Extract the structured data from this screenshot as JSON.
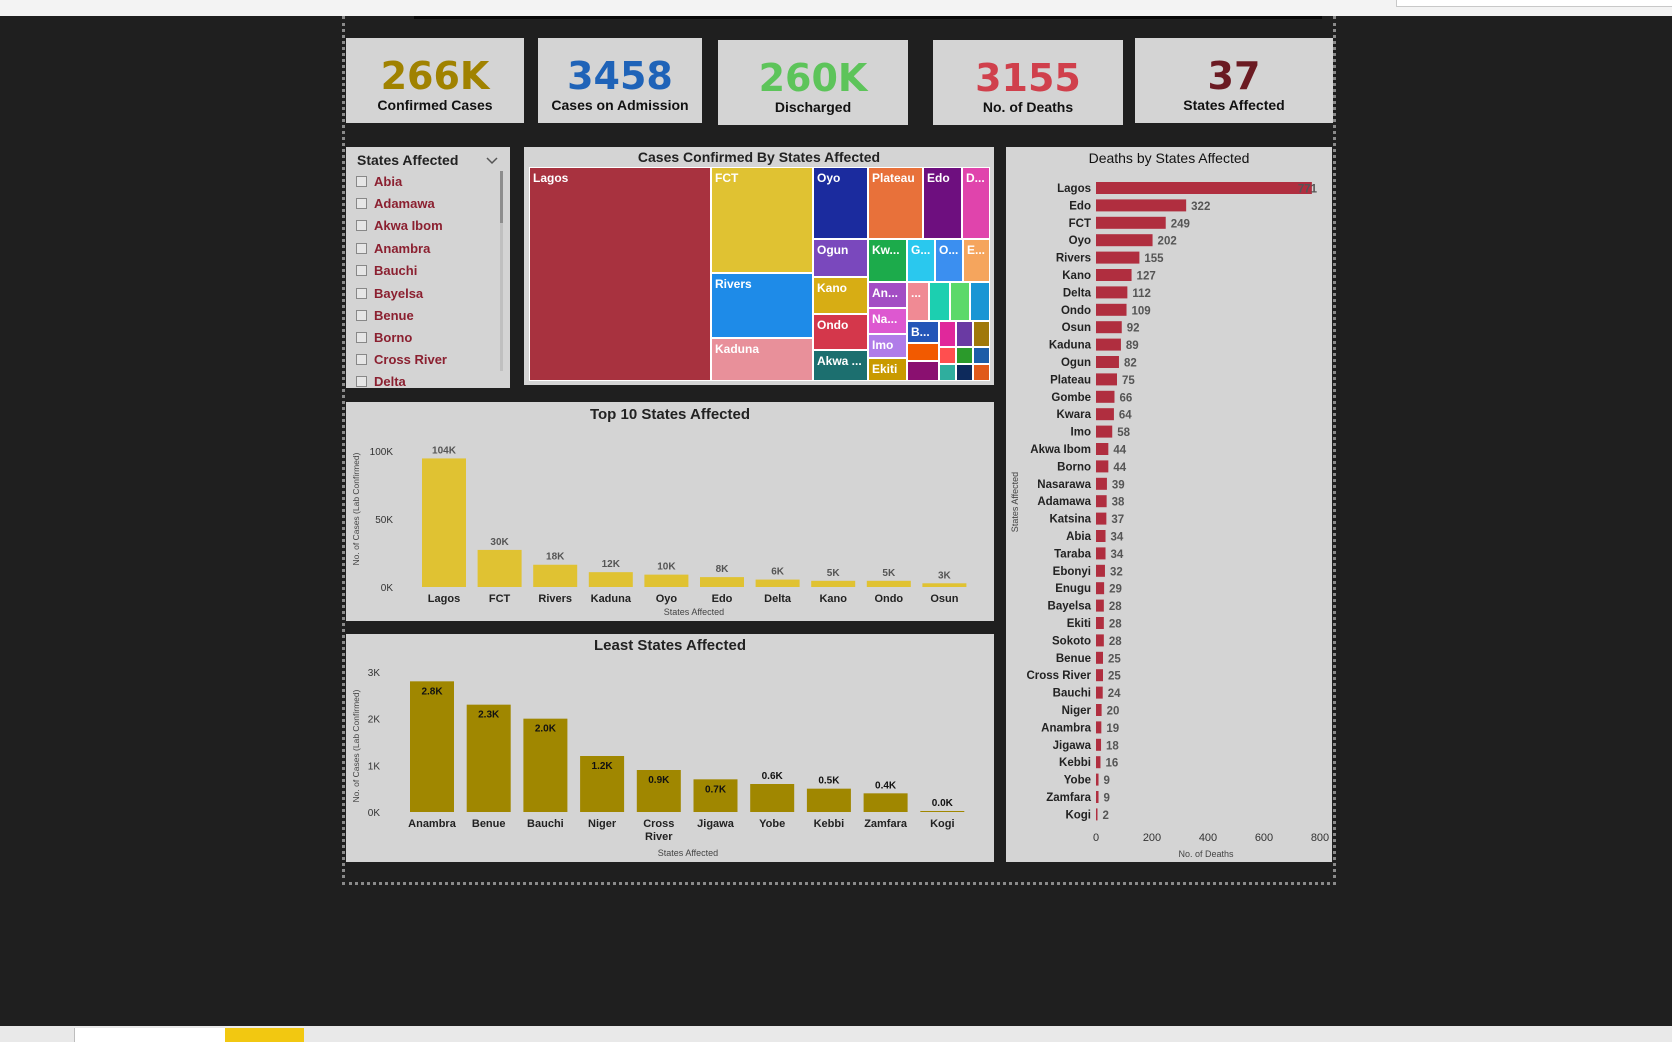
{
  "kpis": [
    {
      "value": "266K",
      "label": "Confirmed Cases",
      "color": "#a08200"
    },
    {
      "value": "3458",
      "label": "Cases on Admission",
      "color": "#1f63b8"
    },
    {
      "value": "260K",
      "label": "Discharged",
      "color": "#5dc45a"
    },
    {
      "value": "3155",
      "label": "No. of Deaths",
      "color": "#d0404c"
    },
    {
      "value": "37",
      "label": "States Affected",
      "color": "#6b1a22"
    }
  ],
  "slicer": {
    "title": "States Affected",
    "items": [
      "Abia",
      "Adamawa",
      "Akwa Ibom",
      "Anambra",
      "Bauchi",
      "Bayelsa",
      "Benue",
      "Borno",
      "Cross River",
      "Delta"
    ]
  },
  "treemap": {
    "title": "Cases Confirmed By States Affected",
    "labels": [
      "Lagos",
      "FCT",
      "Oyo",
      "Plateau",
      "Edo",
      "D...",
      "Ogun",
      "Rivers",
      "Kano",
      "Ondo",
      "Akwa ...",
      "Kw...",
      "G...",
      "O...",
      "E...",
      "An...",
      "...",
      "Na...",
      "Imo",
      "B...",
      "Ekiti"
    ]
  },
  "top10": {
    "title": "Top 10 States Affected"
  },
  "least": {
    "title": "Least States Affected"
  },
  "deaths": {
    "title": "Deaths by States Affected"
  },
  "chart_data": [
    {
      "type": "bar",
      "title": "Top 10 States Affected",
      "xlabel": "States Affected",
      "ylabel": "No. of Cases (Lab Confirmed)",
      "categories": [
        "Lagos",
        "FCT",
        "Rivers",
        "Kaduna",
        "Oyo",
        "Edo",
        "Delta",
        "Kano",
        "Ondo",
        "Osun"
      ],
      "values": [
        104000,
        30000,
        18000,
        12000,
        10000,
        8000,
        6000,
        5000,
        5000,
        3000
      ],
      "data_labels": [
        "104K",
        "30K",
        "18K",
        "12K",
        "10K",
        "8K",
        "6K",
        "5K",
        "5K",
        "3K"
      ],
      "yticks": [
        "0K",
        "50K",
        "100K"
      ],
      "ylim": [
        0,
        110000
      ],
      "color": "#e0c232"
    },
    {
      "type": "bar",
      "title": "Least States Affected",
      "xlabel": "States Affected",
      "ylabel": "No. of Cases (Lab Confirmed)",
      "categories": [
        "Anambra",
        "Benue",
        "Bauchi",
        "Niger",
        "Cross River",
        "Jigawa",
        "Yobe",
        "Kebbi",
        "Zamfara",
        "Kogi"
      ],
      "values": [
        2800,
        2300,
        2000,
        1200,
        900,
        700,
        600,
        500,
        400,
        5
      ],
      "data_labels": [
        "2.8K",
        "2.3K",
        "2.0K",
        "1.2K",
        "0.9K",
        "0.7K",
        "0.6K",
        "0.5K",
        "0.4K",
        "0.0K"
      ],
      "yticks": [
        "0K",
        "1K",
        "2K",
        "3K"
      ],
      "ylim": [
        0,
        3000
      ],
      "color": "#a08700"
    },
    {
      "type": "bar",
      "orientation": "horizontal",
      "title": "Deaths by States Affected",
      "xlabel": "No. of Deaths",
      "ylabel": "States Affected",
      "categories": [
        "Lagos",
        "Edo",
        "FCT",
        "Oyo",
        "Rivers",
        "Kano",
        "Delta",
        "Ondo",
        "Osun",
        "Kaduna",
        "Ogun",
        "Plateau",
        "Gombe",
        "Kwara",
        "Imo",
        "Akwa Ibom",
        "Borno",
        "Nasarawa",
        "Adamawa",
        "Katsina",
        "Abia",
        "Taraba",
        "Ebonyi",
        "Enugu",
        "Bayelsa",
        "Ekiti",
        "Sokoto",
        "Benue",
        "Cross River",
        "Bauchi",
        "Niger",
        "Anambra",
        "Jigawa",
        "Kebbi",
        "Yobe",
        "Zamfara",
        "Kogi"
      ],
      "values": [
        771,
        322,
        249,
        202,
        155,
        127,
        112,
        109,
        92,
        89,
        82,
        75,
        66,
        64,
        58,
        44,
        44,
        39,
        38,
        37,
        34,
        34,
        32,
        29,
        28,
        28,
        28,
        25,
        25,
        24,
        20,
        19,
        18,
        16,
        9,
        9,
        2
      ],
      "data_labels": [
        "771",
        "322",
        "249",
        "202",
        "155",
        "127",
        "112",
        "109",
        "92",
        "89",
        "82",
        "75",
        "66",
        "64",
        "58",
        "44",
        "44",
        "39",
        "38",
        "37",
        "34",
        "34",
        "32",
        "29",
        "28",
        "28",
        "28",
        "25",
        "25",
        "24",
        "20",
        "19",
        "18",
        "16",
        "9",
        "9",
        "2"
      ],
      "xticks": [
        "0",
        "200",
        "400",
        "600",
        "800"
      ],
      "xlim": [
        0,
        800
      ],
      "color": "#b02e3f"
    }
  ]
}
